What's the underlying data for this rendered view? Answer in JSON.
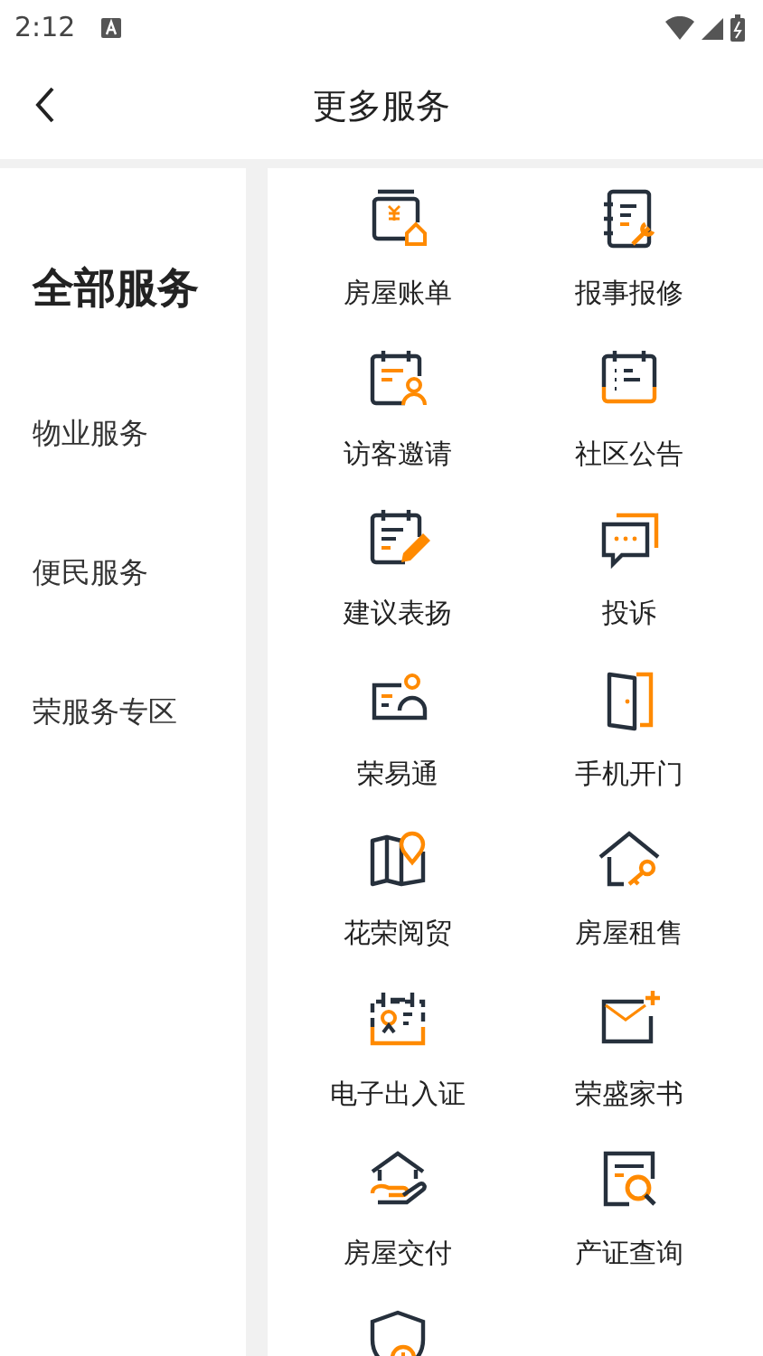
{
  "status_bar": {
    "time": "2:12"
  },
  "header": {
    "title": "更多服务"
  },
  "sidebar": {
    "items": [
      {
        "label": "全部服务",
        "selected": true
      },
      {
        "label": "物业服务",
        "selected": false
      },
      {
        "label": "便民服务",
        "selected": false
      },
      {
        "label": "荣服务专区",
        "selected": false
      }
    ]
  },
  "services": [
    {
      "kind": "service",
      "label": "房屋账单"
    },
    {
      "kind": "service",
      "label": "报事报修"
    },
    {
      "kind": "service",
      "label": "访客邀请"
    },
    {
      "kind": "service",
      "label": "社区公告"
    },
    {
      "kind": "service",
      "label": "建议表扬"
    },
    {
      "kind": "service",
      "label": "投诉"
    },
    {
      "kind": "service",
      "label": "荣易通"
    },
    {
      "kind": "service",
      "label": "手机开门"
    },
    {
      "kind": "service",
      "label": "花荣阅贸"
    },
    {
      "kind": "service",
      "label": "房屋租售"
    },
    {
      "kind": "service",
      "label": "电子出入证"
    },
    {
      "kind": "service",
      "label": "荣盛家书"
    },
    {
      "kind": "service",
      "label": "房屋交付"
    },
    {
      "kind": "service",
      "label": "产证查询"
    },
    {
      "kind": "partial"
    }
  ]
}
